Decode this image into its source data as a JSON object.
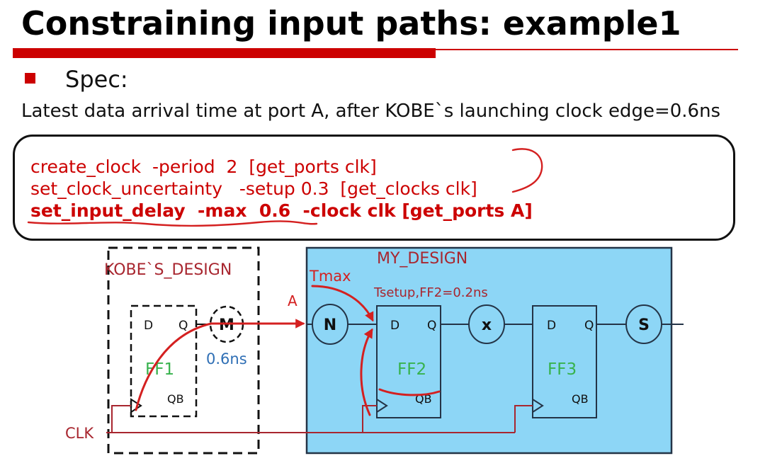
{
  "slide": {
    "title": "Constraining input paths: example1",
    "bullet_label": "Spec:",
    "spec_text": "Latest data arrival time at port A, after KOBE`s launching clock edge=0.6ns"
  },
  "constraints": {
    "lines": [
      "create_clock  -period  2  [get_ports clk]",
      "set_clock_uncertainty   -setup 0.3  [get_clocks clk]",
      "set_input_delay  -max  0.6  -clock clk [get_ports A]"
    ]
  },
  "diagram": {
    "kobe_design": {
      "label": "KOBE`S_DESIGN",
      "ff1": {
        "d": "D",
        "q": "Q",
        "name": "FF1",
        "qb": "QB"
      },
      "m_block": "M",
      "m_delay": "0.6ns"
    },
    "port_a": "A",
    "clk": "CLK",
    "my_design": {
      "label": "MY_DESIGN",
      "tmax": "Tmax",
      "tsetup": "Tsetup,FF2=0.2ns",
      "n_block": "N",
      "ff2": {
        "d": "D",
        "q": "Q",
        "name": "FF2",
        "qb": "QB"
      },
      "x_block": "x",
      "ff3": {
        "d": "D",
        "q": "Q",
        "name": "FF3",
        "qb": "QB"
      },
      "s_block": "S"
    }
  },
  "colors": {
    "accent_red": "#cc0000",
    "annotation_red": "#d42020",
    "label_red": "#a8262f",
    "ff_green": "#37b24d",
    "delay_blue": "#2f6fb5",
    "my_design_fill": "#8dd6f6",
    "wire_dark": "#243447"
  }
}
